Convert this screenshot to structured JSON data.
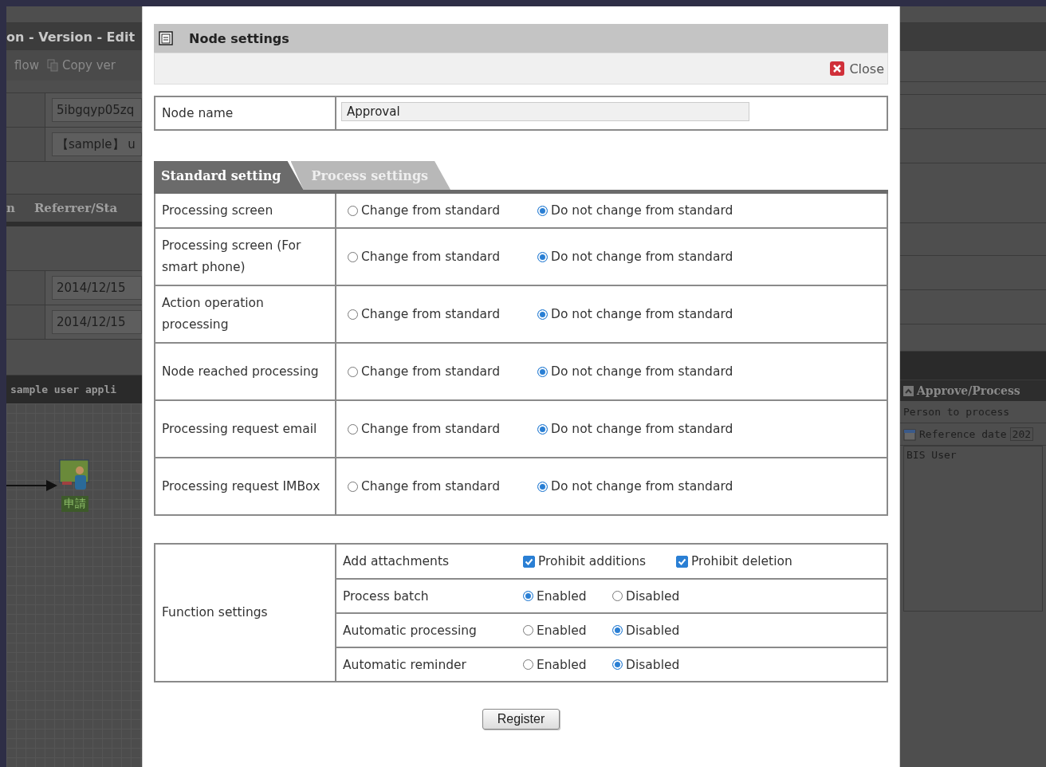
{
  "background": {
    "title": "on - Version - Edit",
    "toolbar": [
      "flow",
      "Copy ver"
    ],
    "fields": [
      "5ibgqyp05zq",
      "【sample】 u"
    ],
    "tabs": [
      "n",
      "Referrer/Sta"
    ],
    "dates": [
      "2014/12/15",
      "2014/12/15"
    ],
    "flow_title": "sample user appli",
    "flow_node_label": "申請",
    "side_panel": {
      "title": "Approve/Process",
      "person_label": "Person to process",
      "date_label": "Reference date",
      "date_value": "202",
      "user": "BIS User"
    }
  },
  "dialog": {
    "title": "Node settings",
    "close": "Close",
    "node_name": {
      "label": "Node name",
      "value": "Approval"
    },
    "tabs": [
      {
        "label": "Standard setting",
        "selected": true
      },
      {
        "label": "Process settings",
        "selected": false
      }
    ],
    "settings": [
      {
        "label": "Processing screen",
        "options": [
          {
            "label": "Change from standard",
            "selected": false
          },
          {
            "label": "Do not change from standard",
            "selected": true
          }
        ]
      },
      {
        "label": "Processing screen (For smart phone)",
        "options": [
          {
            "label": "Change from standard",
            "selected": false
          },
          {
            "label": "Do not change from standard",
            "selected": true
          }
        ]
      },
      {
        "label": "Action operation processing",
        "options": [
          {
            "label": "Change from standard",
            "selected": false
          },
          {
            "label": "Do not change from standard",
            "selected": true
          }
        ]
      },
      {
        "label": "Node reached processing",
        "options": [
          {
            "label": "Change from standard",
            "selected": false
          },
          {
            "label": "Do not change from standard",
            "selected": true
          }
        ]
      },
      {
        "label": "Processing request email",
        "options": [
          {
            "label": "Change from standard",
            "selected": false
          },
          {
            "label": "Do not change from standard",
            "selected": true
          }
        ]
      },
      {
        "label": "Processing request IMBox",
        "options": [
          {
            "label": "Change from standard",
            "selected": false
          },
          {
            "label": "Do not change from standard",
            "selected": true
          }
        ]
      }
    ],
    "function_settings": {
      "label": "Function settings",
      "rows": [
        {
          "label": "Add attachments",
          "kind": "checkbox",
          "options": [
            {
              "label": "Prohibit additions",
              "checked": true
            },
            {
              "label": "Prohibit deletion",
              "checked": true
            }
          ]
        },
        {
          "label": "Process batch",
          "kind": "radio",
          "options": [
            {
              "label": "Enabled",
              "selected": true
            },
            {
              "label": "Disabled",
              "selected": false
            }
          ]
        },
        {
          "label": "Automatic processing",
          "kind": "radio",
          "options": [
            {
              "label": "Enabled",
              "selected": false
            },
            {
              "label": "Disabled",
              "selected": true
            }
          ]
        },
        {
          "label": "Automatic reminder",
          "kind": "radio",
          "options": [
            {
              "label": "Enabled",
              "selected": false
            },
            {
              "label": "Disabled",
              "selected": true
            }
          ]
        }
      ]
    },
    "register": "Register"
  }
}
